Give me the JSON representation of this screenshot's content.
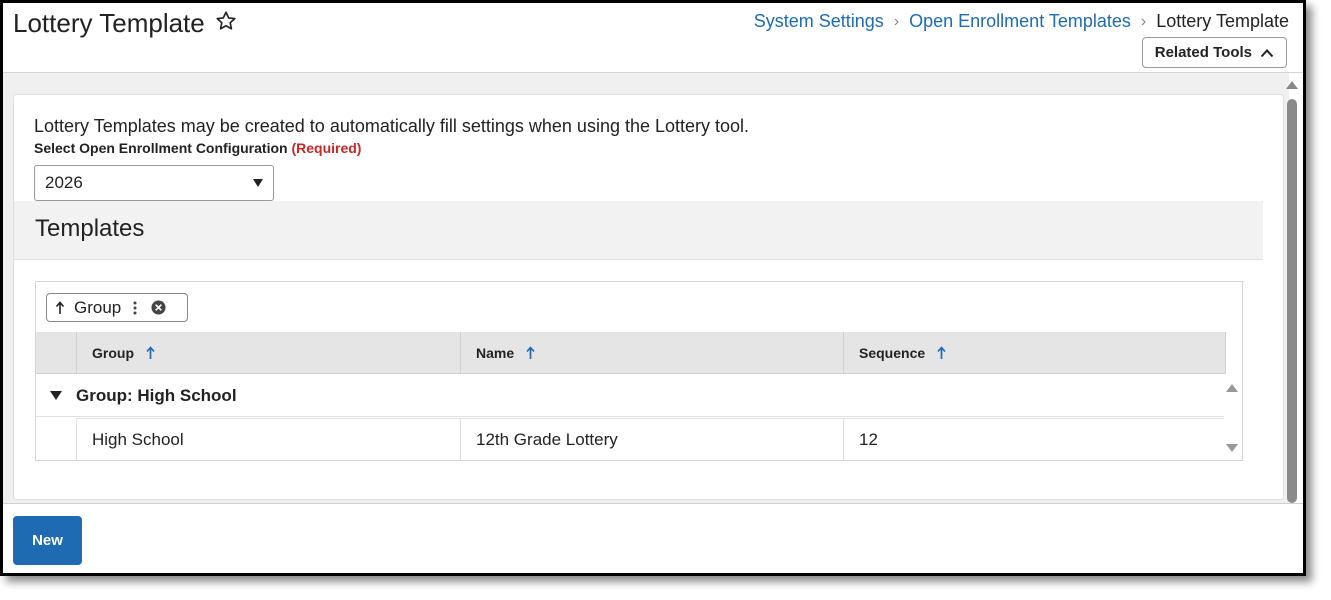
{
  "header": {
    "title": "Lottery Template",
    "favorite_icon": "star-outline-icon",
    "breadcrumb": [
      {
        "label": "System Settings",
        "link": true
      },
      {
        "label": "Open Enrollment Templates",
        "link": true
      },
      {
        "label": "Lottery Template",
        "link": false
      }
    ],
    "related_tools_label": "Related Tools"
  },
  "main": {
    "intro_text": "Lottery Templates may be created to automatically fill settings when using the Lottery tool.",
    "select_label": "Select Open Enrollment Configuration",
    "required_label": "(Required)",
    "selected_configuration": "2026",
    "templates_title": "Templates"
  },
  "grid": {
    "group_chip_label": "Group",
    "columns": [
      "Group",
      "Name",
      "Sequence"
    ],
    "group_row_label": "Group: High School",
    "rows": [
      {
        "group": "High School",
        "name": "12th Grade Lottery",
        "sequence": "12"
      }
    ]
  },
  "footer": {
    "new_label": "New"
  },
  "colors": {
    "accent": "#1f6bb3",
    "required": "#c62828",
    "header_bg": "#e5e5e5"
  }
}
